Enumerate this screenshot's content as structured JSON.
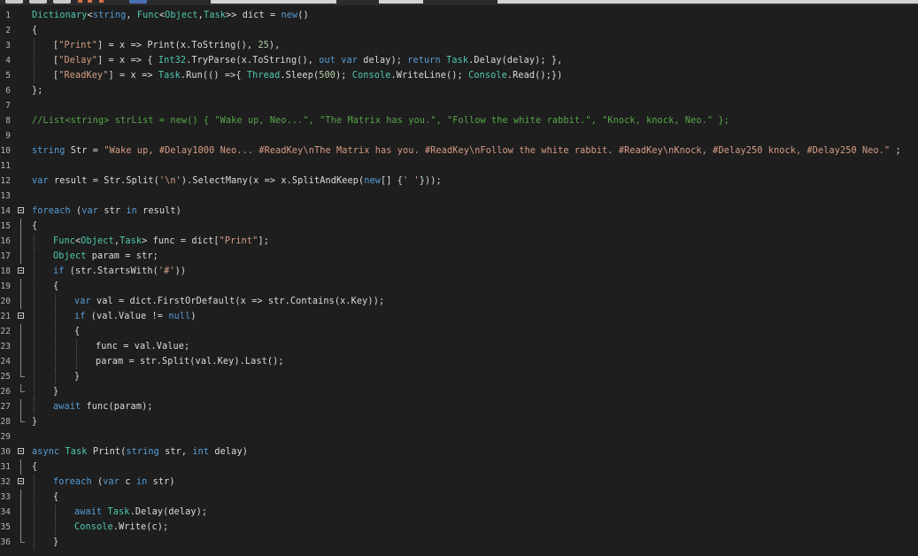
{
  "colors": {
    "background": "#1e1e1e",
    "plain": "#dcdcdc",
    "keyword": "#569cd6",
    "type": "#4ec9b0",
    "string": "#d69d85",
    "number": "#b5cea8",
    "comment": "#57a64a",
    "line_number": "#b5b5b5"
  },
  "icons": [
    "fold-collapse-icon"
  ],
  "editor": {
    "lines": [
      {
        "n": "1",
        "indent": 0,
        "tokens": [
          [
            "t",
            "Dictionary"
          ],
          [
            "p",
            "<"
          ],
          [
            "k",
            "string"
          ],
          [
            "p",
            ", "
          ],
          [
            "t",
            "Func"
          ],
          [
            "p",
            "<"
          ],
          [
            "t",
            "Object"
          ],
          [
            "p",
            ","
          ],
          [
            "t",
            "Task"
          ],
          [
            "p",
            ">> dict = "
          ],
          [
            "k",
            "new"
          ],
          [
            "p",
            "()"
          ]
        ]
      },
      {
        "n": "2",
        "indent": 0,
        "tokens": [
          [
            "p",
            "{"
          ]
        ]
      },
      {
        "n": "3",
        "indent": 1,
        "tokens": [
          [
            "p",
            "["
          ],
          [
            "s",
            "\"Print\""
          ],
          [
            "p",
            "] = x => Print(x.ToString(), "
          ],
          [
            "n",
            "25"
          ],
          [
            "p",
            "),"
          ]
        ]
      },
      {
        "n": "4",
        "indent": 1,
        "tokens": [
          [
            "p",
            "["
          ],
          [
            "s",
            "\"Delay\""
          ],
          [
            "p",
            "] = x => { "
          ],
          [
            "t",
            "Int32"
          ],
          [
            "p",
            ".TryParse(x.ToString(), "
          ],
          [
            "k",
            "out var"
          ],
          [
            "p",
            " delay); "
          ],
          [
            "k",
            "return"
          ],
          [
            "p",
            " "
          ],
          [
            "t",
            "Task"
          ],
          [
            "p",
            ".Delay(delay); },"
          ]
        ]
      },
      {
        "n": "5",
        "indent": 1,
        "tokens": [
          [
            "p",
            "["
          ],
          [
            "s",
            "\"ReadKey\""
          ],
          [
            "p",
            "] = x => "
          ],
          [
            "t",
            "Task"
          ],
          [
            "p",
            ".Run(() =>{ "
          ],
          [
            "t",
            "Thread"
          ],
          [
            "p",
            ".Sleep("
          ],
          [
            "n",
            "500"
          ],
          [
            "p",
            "); "
          ],
          [
            "t",
            "Console"
          ],
          [
            "p",
            ".WriteLine(); "
          ],
          [
            "t",
            "Console"
          ],
          [
            "p",
            ".Read();})"
          ]
        ]
      },
      {
        "n": "6",
        "indent": 0,
        "tokens": [
          [
            "p",
            "};"
          ]
        ]
      },
      {
        "n": "7",
        "indent": 0,
        "tokens": []
      },
      {
        "n": "8",
        "indent": 0,
        "tokens": [
          [
            "c",
            "//List<string> strList = new() { \"Wake up, Neo...\", \"The Matrix has you.\", \"Follow the white rabbit.\", \"Knock, knock, Neo.\" };"
          ]
        ]
      },
      {
        "n": "9",
        "indent": 0,
        "tokens": []
      },
      {
        "n": "10",
        "indent": 0,
        "tokens": [
          [
            "k",
            "string"
          ],
          [
            "p",
            " Str = "
          ],
          [
            "s",
            "\"Wake up, #Delay1000 Neo... #ReadKey\\nThe Matrix has you. #ReadKey\\nFollow the white rabbit. #ReadKey\\nKnock, #Delay250 knock, #Delay250 Neo.\""
          ],
          [
            "p",
            " ;"
          ]
        ]
      },
      {
        "n": "11",
        "indent": 0,
        "tokens": []
      },
      {
        "n": "12",
        "indent": 0,
        "tokens": [
          [
            "k",
            "var"
          ],
          [
            "p",
            " result = Str.Split("
          ],
          [
            "s",
            "'\\n'"
          ],
          [
            "p",
            ").SelectMany(x => x.SplitAndKeep("
          ],
          [
            "k",
            "new"
          ],
          [
            "p",
            "[] {"
          ],
          [
            "s",
            "' '"
          ],
          [
            "p",
            "}));"
          ]
        ]
      },
      {
        "n": "13",
        "indent": 0,
        "tokens": []
      },
      {
        "n": "14",
        "indent": 0,
        "fold": "open",
        "tokens": [
          [
            "k",
            "foreach"
          ],
          [
            "p",
            " ("
          ],
          [
            "k",
            "var"
          ],
          [
            "p",
            " str "
          ],
          [
            "k",
            "in"
          ],
          [
            "p",
            " result)"
          ]
        ]
      },
      {
        "n": "15",
        "indent": 0,
        "fold": "line",
        "tokens": [
          [
            "p",
            "{"
          ]
        ]
      },
      {
        "n": "16",
        "indent": 1,
        "fold": "line",
        "tokens": [
          [
            "t",
            "Func"
          ],
          [
            "p",
            "<"
          ],
          [
            "t",
            "Object"
          ],
          [
            "p",
            ","
          ],
          [
            "t",
            "Task"
          ],
          [
            "p",
            "> func = dict["
          ],
          [
            "s",
            "\"Print\""
          ],
          [
            "p",
            "];"
          ]
        ]
      },
      {
        "n": "17",
        "indent": 1,
        "fold": "line",
        "tokens": [
          [
            "t",
            "Object"
          ],
          [
            "p",
            " param = str;"
          ]
        ]
      },
      {
        "n": "18",
        "indent": 1,
        "fold": "open",
        "tokens": [
          [
            "k",
            "if"
          ],
          [
            "p",
            " (str.StartsWith("
          ],
          [
            "s",
            "'#'"
          ],
          [
            "p",
            "))"
          ]
        ]
      },
      {
        "n": "19",
        "indent": 1,
        "fold": "line",
        "tokens": [
          [
            "p",
            "{"
          ]
        ]
      },
      {
        "n": "20",
        "indent": 2,
        "fold": "line",
        "tokens": [
          [
            "k",
            "var"
          ],
          [
            "p",
            " val = dict.FirstOrDefault(x => str.Contains(x.Key));"
          ]
        ]
      },
      {
        "n": "21",
        "indent": 2,
        "fold": "open",
        "tokens": [
          [
            "k",
            "if"
          ],
          [
            "p",
            " (val.Value != "
          ],
          [
            "k",
            "null"
          ],
          [
            "p",
            ")"
          ]
        ]
      },
      {
        "n": "22",
        "indent": 2,
        "fold": "line",
        "tokens": [
          [
            "p",
            "{"
          ]
        ]
      },
      {
        "n": "23",
        "indent": 3,
        "fold": "line",
        "tokens": [
          [
            "p",
            "func = val.Value;"
          ]
        ]
      },
      {
        "n": "24",
        "indent": 3,
        "fold": "line",
        "tokens": [
          [
            "p",
            "param = str.Split(val.Key).Last();"
          ]
        ]
      },
      {
        "n": "25",
        "indent": 2,
        "fold": "end",
        "tokens": [
          [
            "p",
            "}"
          ]
        ]
      },
      {
        "n": "26",
        "indent": 1,
        "fold": "end",
        "tokens": [
          [
            "p",
            "}"
          ]
        ]
      },
      {
        "n": "27",
        "indent": 1,
        "fold": "line",
        "tokens": [
          [
            "k",
            "await"
          ],
          [
            "p",
            " func(param);"
          ]
        ]
      },
      {
        "n": "28",
        "indent": 0,
        "fold": "end",
        "tokens": [
          [
            "p",
            "}"
          ]
        ]
      },
      {
        "n": "29",
        "indent": 0,
        "tokens": []
      },
      {
        "n": "30",
        "indent": 0,
        "fold": "open",
        "tokens": [
          [
            "k",
            "async"
          ],
          [
            "p",
            " "
          ],
          [
            "t",
            "Task"
          ],
          [
            "p",
            " Print("
          ],
          [
            "k",
            "string"
          ],
          [
            "p",
            " str, "
          ],
          [
            "k",
            "int"
          ],
          [
            "p",
            " delay)"
          ]
        ]
      },
      {
        "n": "31",
        "indent": 0,
        "fold": "line",
        "tokens": [
          [
            "p",
            "{"
          ]
        ]
      },
      {
        "n": "32",
        "indent": 1,
        "fold": "open",
        "tokens": [
          [
            "k",
            "foreach"
          ],
          [
            "p",
            " ("
          ],
          [
            "k",
            "var"
          ],
          [
            "p",
            " c "
          ],
          [
            "k",
            "in"
          ],
          [
            "p",
            " str)"
          ]
        ]
      },
      {
        "n": "33",
        "indent": 1,
        "fold": "line",
        "tokens": [
          [
            "p",
            "{"
          ]
        ]
      },
      {
        "n": "34",
        "indent": 2,
        "fold": "line",
        "tokens": [
          [
            "k",
            "await"
          ],
          [
            "p",
            " "
          ],
          [
            "t",
            "Task"
          ],
          [
            "p",
            ".Delay(delay);"
          ]
        ]
      },
      {
        "n": "35",
        "indent": 2,
        "fold": "line",
        "tokens": [
          [
            "t",
            "Console"
          ],
          [
            "p",
            ".Write(c);"
          ]
        ]
      },
      {
        "n": "36",
        "indent": 1,
        "fold": "end",
        "tokens": [
          [
            "p",
            "}"
          ]
        ]
      }
    ]
  }
}
